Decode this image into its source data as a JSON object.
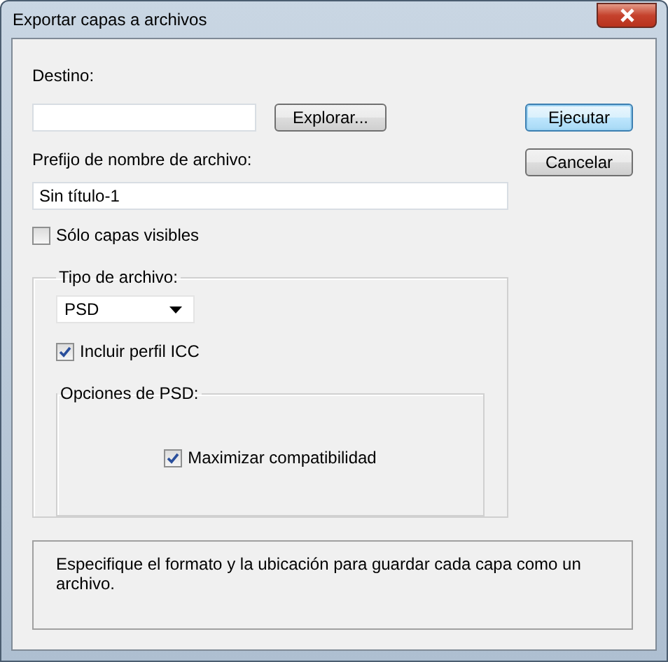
{
  "window": {
    "title": "Exportar capas a archivos"
  },
  "destination": {
    "label": "Destino:"
  },
  "browse_button": "Explorar...",
  "prefix": {
    "label": "Prefijo de nombre de archivo:",
    "value": "Sin título-1"
  },
  "visible_only": {
    "label": "Sólo capas visibles",
    "checked": false
  },
  "file_type": {
    "legend": "Tipo de archivo:",
    "value": "PSD",
    "include_icc": {
      "label": "Incluir perfil ICC",
      "checked": true
    }
  },
  "psd_options": {
    "legend": "Opciones de PSD:",
    "maximize": {
      "label": "Maximizar compatibilidad",
      "checked": true
    }
  },
  "buttons": [
    {
      "label": "Ejecutar",
      "default": true
    },
    {
      "label": "Cancelar",
      "default": false
    }
  ],
  "description": "Especifique el formato y la ubicación para guardar cada capa como un archivo."
}
